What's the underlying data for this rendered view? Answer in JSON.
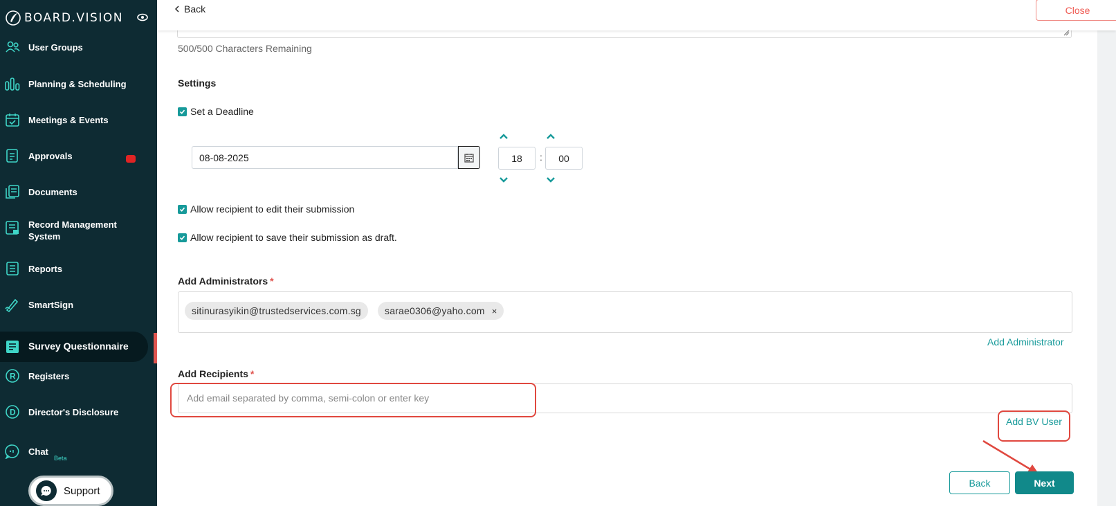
{
  "brand": {
    "name": "BOARD.VISION"
  },
  "sidebar": {
    "items": [
      {
        "label": "User Groups",
        "icon": "users-icon"
      },
      {
        "label": "Planning & Scheduling",
        "icon": "planning-icon"
      },
      {
        "label": "Meetings & Events",
        "icon": "calendar-check-icon"
      },
      {
        "label": "Approvals",
        "icon": "approvals-icon"
      },
      {
        "label": "Documents",
        "icon": "documents-icon"
      },
      {
        "label": "Record Management\nSystem",
        "icon": "record-management-icon"
      },
      {
        "label": "Reports",
        "icon": "reports-icon"
      },
      {
        "label": "SmartSign",
        "icon": "smartsign-icon"
      },
      {
        "label": "Survey Questionnaire",
        "icon": "survey-icon",
        "active": true
      },
      {
        "label": "Registers",
        "icon": "registers-icon"
      },
      {
        "label": "Director's Disclosure",
        "icon": "disclosure-icon"
      },
      {
        "label": "Chat",
        "icon": "chat-icon",
        "badge": "Beta"
      }
    ],
    "support_label": "Support"
  },
  "topbar": {
    "back_label": "Back",
    "close_label": "Close"
  },
  "form": {
    "char_remaining": "500/500 Characters Remaining",
    "settings_title": "Settings",
    "deadline_label": "Set a Deadline",
    "deadline_date": "08-08-2025",
    "deadline_hour": "18",
    "deadline_minute": "00",
    "time_separator": ":",
    "allow_edit_label": "Allow recipient to edit their submission",
    "allow_draft_label": "Allow recipient to save their submission as draft.",
    "admins_title": "Add Administrators",
    "required_mark": "*",
    "admins": [
      "sitinurasyikin@trustedservices.com.sg",
      "sarae0306@yaho.com"
    ],
    "chip_remove": "×",
    "add_admin_link": "Add Administrator",
    "recipients_title": "Add Recipients",
    "recipients_placeholder": "Add email separated by comma, semi-colon or enter key",
    "add_bv_user_link": "Add BV User"
  },
  "footer": {
    "back_label": "Back",
    "next_label": "Next"
  },
  "colors": {
    "accent": "#179a9a",
    "sidebar_bg": "#0e2b33",
    "highlight": "#e0483f"
  }
}
